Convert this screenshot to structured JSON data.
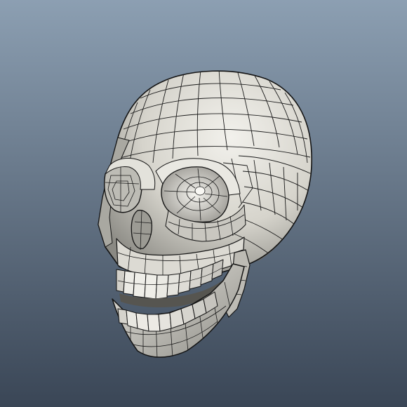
{
  "viewport": {
    "name": "3d-viewport",
    "background": {
      "top_color": "#8c9fb2",
      "bottom_color": "#3a4656"
    },
    "model": {
      "name": "skull",
      "display_mode": "shaded-with-wireframe",
      "surface_color": "#d8d6cf",
      "shadow_color": "#4a4a48",
      "wire_color": "#141414"
    }
  }
}
